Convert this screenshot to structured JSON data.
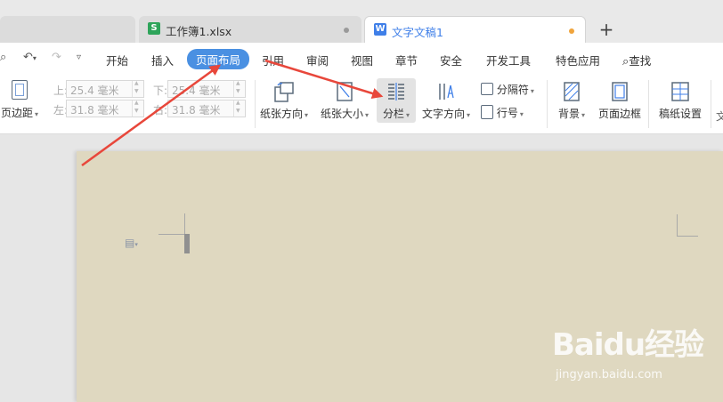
{
  "tabs": [
    {
      "name": "工作簿1.xlsx",
      "icon": "S",
      "icon_color": "#2ea45a",
      "active": false,
      "dot_color": "#9a9a9a"
    },
    {
      "name": "文字文稿1",
      "icon": "W",
      "icon_color": "#3f7fe8",
      "active": true,
      "dot_color": "#f0a43c"
    }
  ],
  "new_tab_symbol": "+",
  "menu": {
    "items": [
      "开始",
      "插入",
      "页面布局",
      "引用",
      "审阅",
      "视图",
      "章节",
      "安全",
      "开发工具",
      "特色应用"
    ],
    "active_index": 2,
    "search_label": "查找",
    "accent_color": "#4a90e2"
  },
  "ribbon": {
    "margins_label": "页边距",
    "top_label": "上:",
    "top_value": "25.4 毫米",
    "bottom_label": "下:",
    "bottom_value": "25.4 毫米",
    "left_label": "左:",
    "left_value": "31.8 毫米",
    "right_label": "右:",
    "right_value": "31.8 毫米",
    "orientation_label": "纸张方向",
    "size_label": "纸张大小",
    "columns_label": "分栏",
    "text_direction_label": "文字方向",
    "breaks_label": "分隔符",
    "line_numbers_label": "行号",
    "background_label": "背景",
    "page_border_label": "页面边框",
    "manuscript_label": "稿纸设置"
  },
  "document": {
    "page_color": "#dfd8c0"
  },
  "watermark": {
    "main": "Baidu经验",
    "sub": "jingyan.baidu.com"
  },
  "annotation_color": "#e8473b"
}
